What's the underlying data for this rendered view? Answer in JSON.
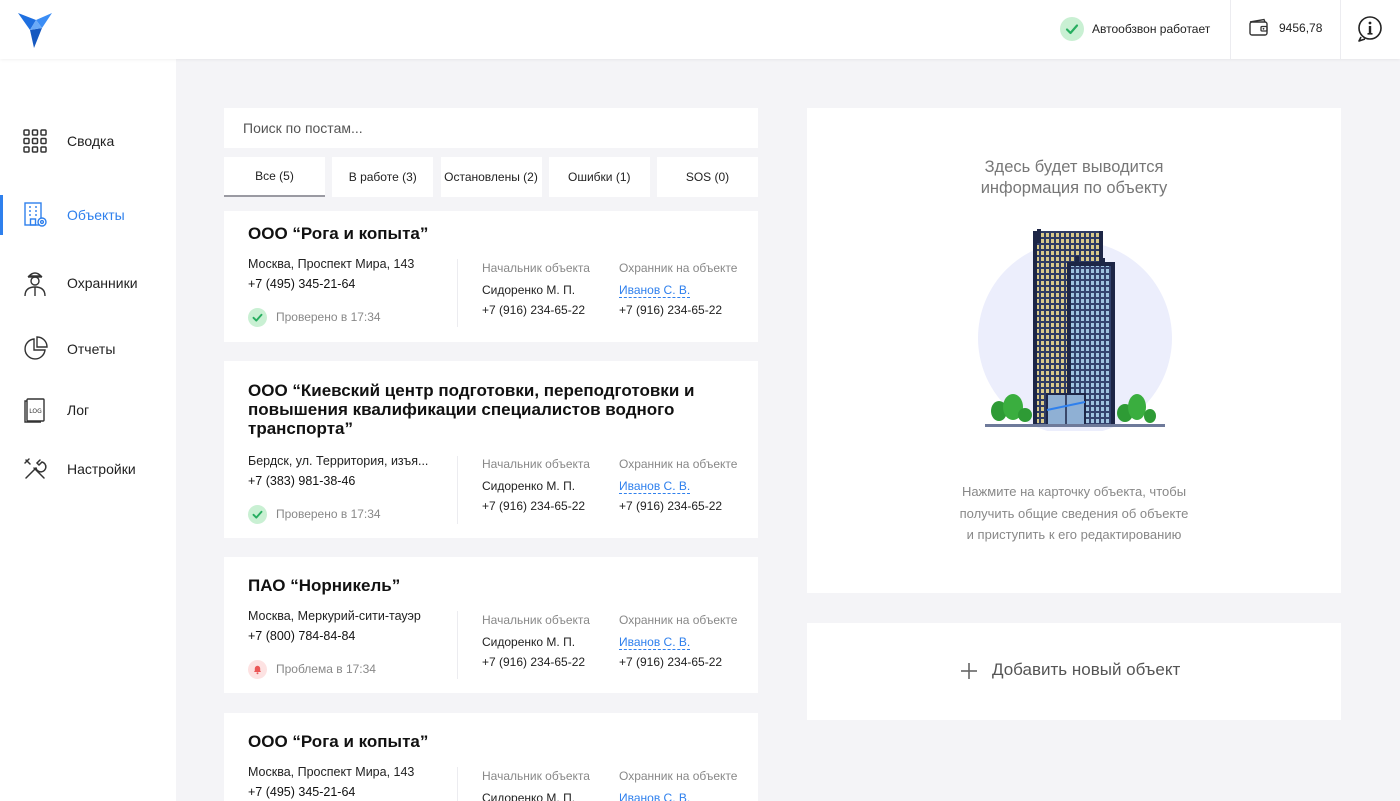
{
  "header": {
    "logo": "bird-logo",
    "autodial_status": "Автообзвон работает",
    "balance": "9456,78",
    "colors": {
      "accent": "#2f80ed",
      "success": "#27ae60",
      "success_bg": "#c9f0d3",
      "alert": "#eb5757",
      "alert_bg": "#fde2e2"
    }
  },
  "sidebar": {
    "items": [
      {
        "label": "Сводка",
        "icon": "grid-icon"
      },
      {
        "label": "Объекты",
        "icon": "building-icon"
      },
      {
        "label": "Охранники",
        "icon": "guard-icon"
      },
      {
        "label": "Отчеты",
        "icon": "pie-chart-icon"
      },
      {
        "label": "Лог",
        "icon": "log-icon"
      },
      {
        "label": "Настройки",
        "icon": "tools-icon"
      }
    ],
    "active": "Объекты"
  },
  "search": {
    "placeholder": "Поиск по постам..."
  },
  "filters": [
    {
      "label": "Все (5)"
    },
    {
      "label": "В работе (3)"
    },
    {
      "label": "Остановлены (2)"
    },
    {
      "label": "Ошибки (1)"
    },
    {
      "label": "SOS (0)"
    }
  ],
  "columns": {
    "chief": "Начальник объекта",
    "guard": "Охранник на объекте"
  },
  "cards": [
    {
      "title": "ООО “Рога и копыта”",
      "address": "Москва, Проспект Мира, 143",
      "phone": "+7 (495) 345-21-64",
      "status": "Проверено в 17:34",
      "chief_name": "Сидоренко М. П.",
      "chief_phone": "+7 (916) 234-65-22",
      "guard_name": "Иванов С. В.",
      "guard_phone": "+7 (916) 234-65-22"
    },
    {
      "title": "ООО “Киевский центр подготовки, переподготовки и повышения квалификации специалистов водного транспорта”",
      "address": "Бердск,  ул. Территория, изъя...",
      "phone": "+7 (383) 981-38-46",
      "status": "Проверено в 17:34",
      "chief_name": "Сидоренко М. П.",
      "chief_phone": "+7 (916) 234-65-22",
      "guard_name": "Иванов С. В.",
      "guard_phone": "+7 (916) 234-65-22"
    },
    {
      "title": "ПАО “Норникель”",
      "address": "Москва, Меркурий-сити-тауэр",
      "phone": "+7 (800) 784-84-84",
      "status": "Проблема в 17:34",
      "chief_name": "Сидоренко М. П.",
      "chief_phone": "+7 (916) 234-65-22",
      "guard_name": "Иванов С. В.",
      "guard_phone": "+7 (916) 234-65-22"
    },
    {
      "title": "ООО “Рога и копыта”",
      "address": "Москва, Проспект Мира, 143",
      "phone": "+7 (495) 345-21-64",
      "chief_name": "Сидоренко М. П.",
      "guard_name": "Иванов С. В."
    }
  ],
  "info_panel": {
    "title_line1": "Здесь будет выводится",
    "title_line2": "информация по объекту",
    "hint_line1": "Нажмите на карточку объекта, чтобы",
    "hint_line2": "получить общие сведения об объекте",
    "hint_line3": "и приступить к его редактированию",
    "illustration": "office-building-illustration"
  },
  "add_object": {
    "label": "Добавить новый объект"
  }
}
